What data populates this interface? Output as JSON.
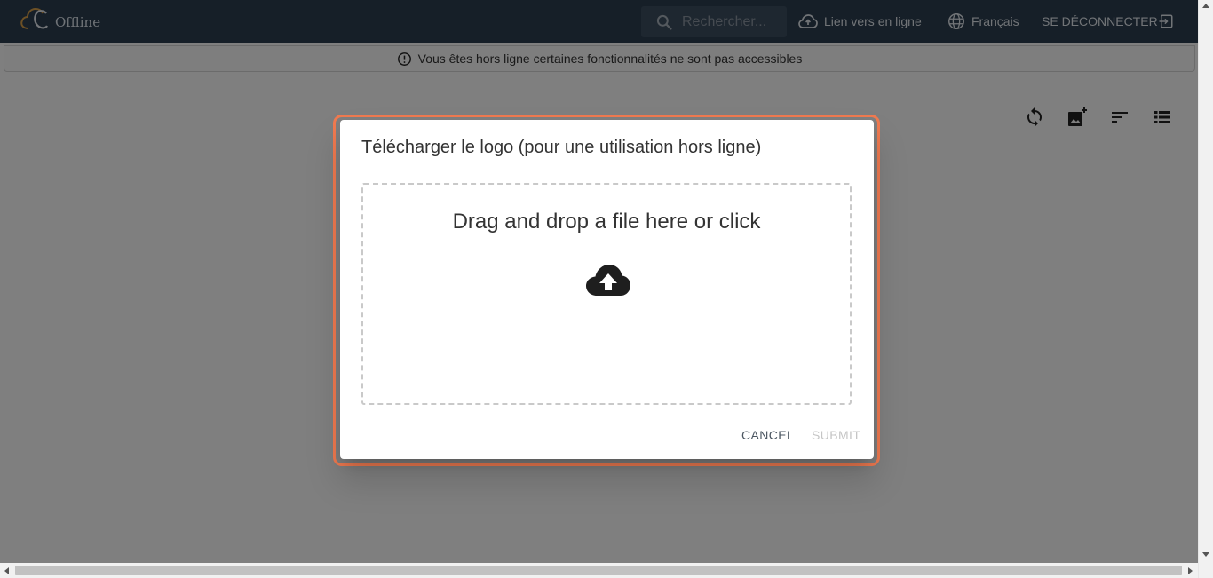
{
  "appbar": {
    "logo_text": "Offline",
    "search_placeholder": "Rechercher...",
    "online_link_label": "Lien vers en ligne",
    "language_label": "Français",
    "logout_label": "SE DÉCONNECTER"
  },
  "banner": {
    "message": "Vous êtes hors ligne certaines fonctionnalités ne sont pas accessibles"
  },
  "toolbar": {
    "icons": [
      "sync-icon",
      "add-photo-icon",
      "sort-icon",
      "list-view-icon"
    ]
  },
  "dialog": {
    "title": "Télécharger le logo (pour une utilisation hors ligne)",
    "dropzone_text": "Drag and drop a file here or click",
    "cancel_label": "CANCEL",
    "submit_label": "SUBMIT",
    "highlight_color": "#f07a50"
  },
  "colors": {
    "appbar_bg": "#2c3e50",
    "overlay": "rgba(0,0,0,0.5)"
  }
}
